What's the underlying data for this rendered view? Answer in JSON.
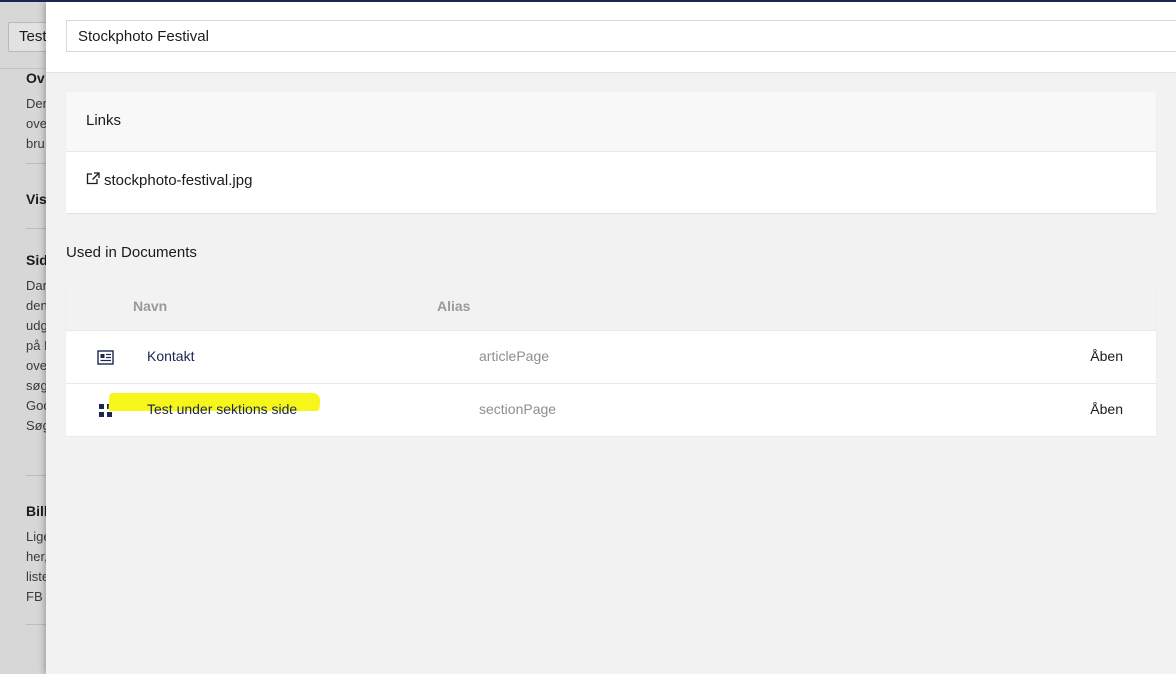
{
  "background_page": {
    "tab_label": "Test",
    "headings": [
      "Ov",
      "Vis",
      "Sid",
      "Bill"
    ],
    "paragraph1": [
      "Der",
      "ove",
      "bru"
    ],
    "paragraph2": [
      "Dar",
      "den",
      "udg",
      "på F",
      "ove",
      "søg",
      "Goo",
      "Søg"
    ],
    "paragraph3": [
      "Lige",
      "her,",
      "liste",
      "FB c"
    ]
  },
  "panel": {
    "title_value": "Stockphoto Festival",
    "links": {
      "heading": "Links",
      "items": [
        {
          "label": "stockphoto-festival.jpg",
          "icon": "external-link-icon"
        }
      ]
    },
    "used_in": {
      "heading": "Used in Documents",
      "columns": {
        "name": "Navn",
        "alias": "Alias"
      },
      "rows": [
        {
          "name": "Kontakt",
          "alias": "articlePage",
          "action": "Åben",
          "icon": "article-page-icon"
        },
        {
          "name": "Test under sektions side",
          "alias": "sectionPage",
          "action": "Åben",
          "icon": "section-grid-icon",
          "highlight_color": "#f6f61a"
        }
      ]
    }
  },
  "colors": {
    "accent_navy": "#1b264f",
    "panel_bg": "#f3f2f2",
    "highlight": "#f6f61a"
  }
}
